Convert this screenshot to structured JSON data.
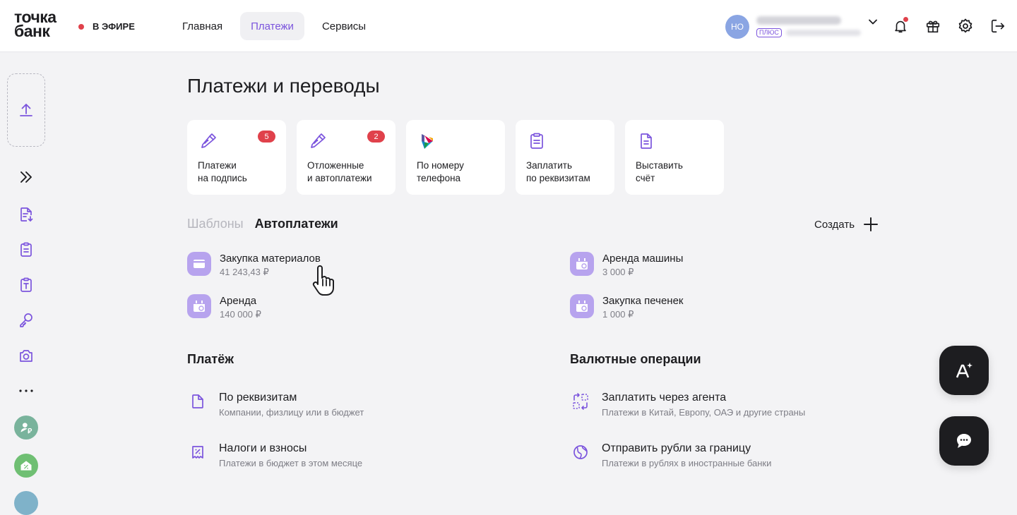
{
  "header": {
    "logo_line1": "точка",
    "logo_line2": "банк",
    "live_label": "В ЭФИРЕ",
    "nav": [
      {
        "label": "Главная",
        "active": false
      },
      {
        "label": "Платежи",
        "active": true
      },
      {
        "label": "Сервисы",
        "active": false
      }
    ],
    "user": {
      "initials": "НО",
      "plan_badge": "ПЛЮС"
    },
    "icons": [
      "bell-icon",
      "gift-icon",
      "gear-icon",
      "logout-icon"
    ]
  },
  "sidebar": {
    "items": [
      "upload-icon",
      "expand-icon",
      "document-import-icon",
      "clipboard-icon",
      "tax-document-icon",
      "key-icon",
      "camera-icon",
      "more-icon",
      "user-ruble-avatar",
      "house-percent-avatar"
    ]
  },
  "page": {
    "title": "Платежи и переводы",
    "quick_cards": [
      {
        "icon": "pen-icon",
        "label": "Платежи\nна подпись",
        "count": "5"
      },
      {
        "icon": "pen-icon",
        "label": "Отложенные\nи автоплатежи",
        "count": "2"
      },
      {
        "icon": "sbp-icon",
        "label": "По номеру\nтелефона",
        "count": ""
      },
      {
        "icon": "clipboard-icon",
        "label": "Заплатить\nпо реквизитам",
        "count": ""
      },
      {
        "icon": "document-icon",
        "label": "Выставить\nсчёт",
        "count": ""
      }
    ],
    "subtabs": {
      "templates": "Шаблоны",
      "autopayments": "Автоплатежи",
      "create": "Создать"
    },
    "autopayments": [
      {
        "name": "Закупка материалов",
        "amount": "41 243,43 ₽"
      },
      {
        "name": "Аренда",
        "amount": "140 000 ₽"
      },
      {
        "name": "Аренда машины",
        "amount": "3 000 ₽"
      },
      {
        "name": "Закупка печенек",
        "amount": "1 000 ₽"
      }
    ],
    "payment_section": {
      "title": "Платёж",
      "items": [
        {
          "name": "По реквизитам",
          "desc": "Компании, физлицу или в бюджет"
        },
        {
          "name": "Налоги и взносы",
          "desc": "Платежи в бюджет в этом месяце"
        }
      ]
    },
    "currency_section": {
      "title": "Валютные операции",
      "items": [
        {
          "name": "Заплатить через агента",
          "desc": "Платежи в Китай, Европу, ОАЭ и другие страны"
        },
        {
          "name": "Отправить рубли за границу",
          "desc": "Платежи в рублях в иностранные банки"
        }
      ]
    }
  },
  "colors": {
    "accent": "#7b54dd",
    "badge": "#e0414b",
    "tile": "#b7a3ee",
    "fab": "#1d1d20"
  }
}
